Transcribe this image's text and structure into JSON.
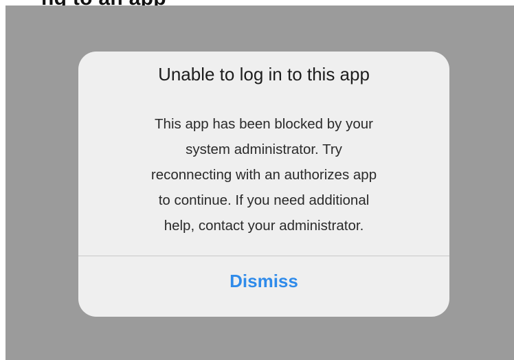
{
  "header": {
    "partial_title": "ng to an app"
  },
  "alert": {
    "title": "Unable to log in to this app",
    "message_lines": [
      "This app has been blocked by your",
      "system administrator. Try",
      "reconnecting with an authorizes app",
      "to continue. If you need additional",
      "help, contact your administrator."
    ],
    "dismiss_label": "Dismiss"
  },
  "colors": {
    "backdrop": "#9b9b9b",
    "alert_background": "#efefef",
    "action_blue": "#2f8bea"
  }
}
